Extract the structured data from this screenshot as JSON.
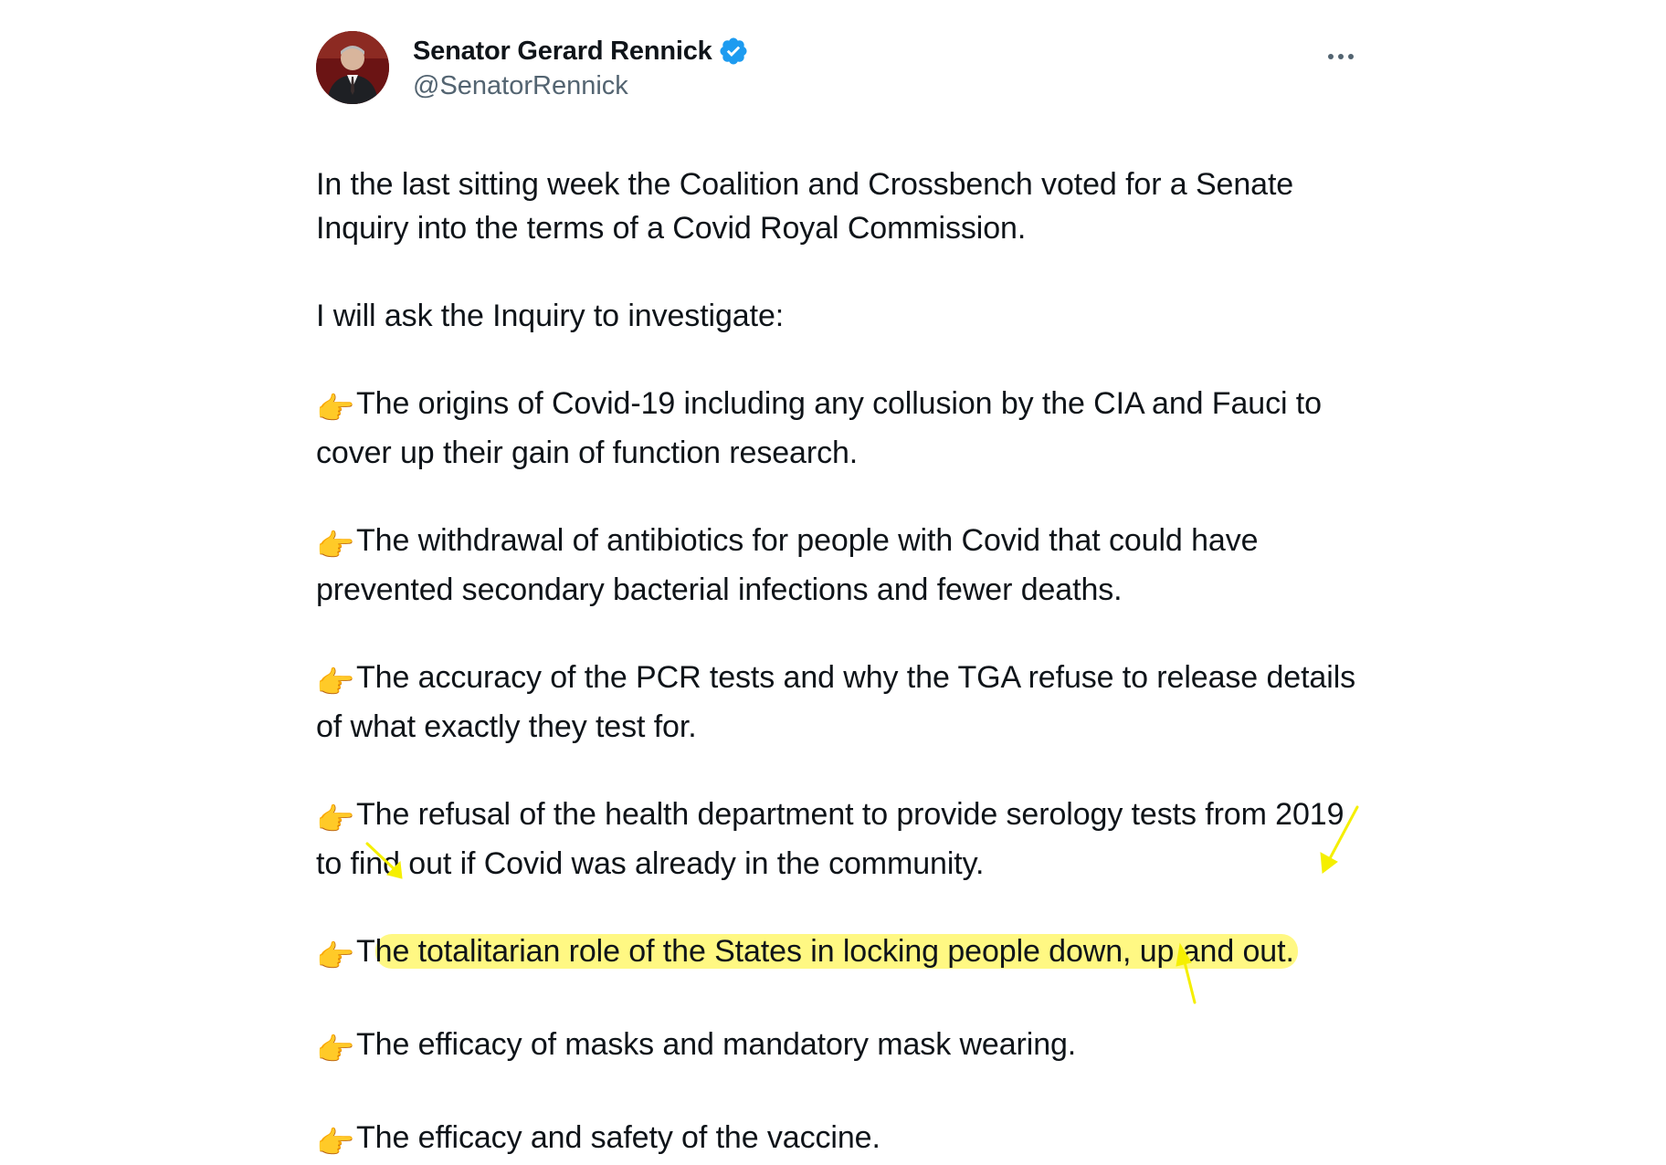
{
  "author": {
    "display_name": "Senator Gerard Rennick",
    "handle": "@SenatorRennick",
    "verified": true,
    "avatar_icon": "profile-photo"
  },
  "more_icon": "more-options-icon",
  "tweet": {
    "intro": "In the last sitting week the Coalition and Crossbench voted for a Senate Inquiry into the terms of a Covid Royal Commission.",
    "ask": "I will ask the Inquiry to investigate:",
    "bullet_icon": "👉",
    "points": [
      "The origins of Covid-19 including any collusion by the CIA and Fauci to cover up their gain of function research.",
      "The withdrawal of antibiotics for people with Covid that could have prevented secondary bacterial infections and fewer deaths.",
      "The accuracy of the PCR tests and why the TGA refuse to release details of what exactly they test for.",
      "The refusal of the health department to provide serology tests from 2019 to find out if Covid was already in the community."
    ],
    "highlighted_point": {
      "prefix": "T",
      "highlighted": "he totalitarian role of the States in locking people down, up and out."
    },
    "points_after": [
      "The efficacy of masks and mandatory mask wearing.",
      "The efficacy and safety of the vaccine."
    ]
  },
  "colors": {
    "verified_badge": "#1d9bf0",
    "highlight": "#fff55a",
    "annotation_arrow": "#f5ef00",
    "secondary_text": "#536471"
  }
}
